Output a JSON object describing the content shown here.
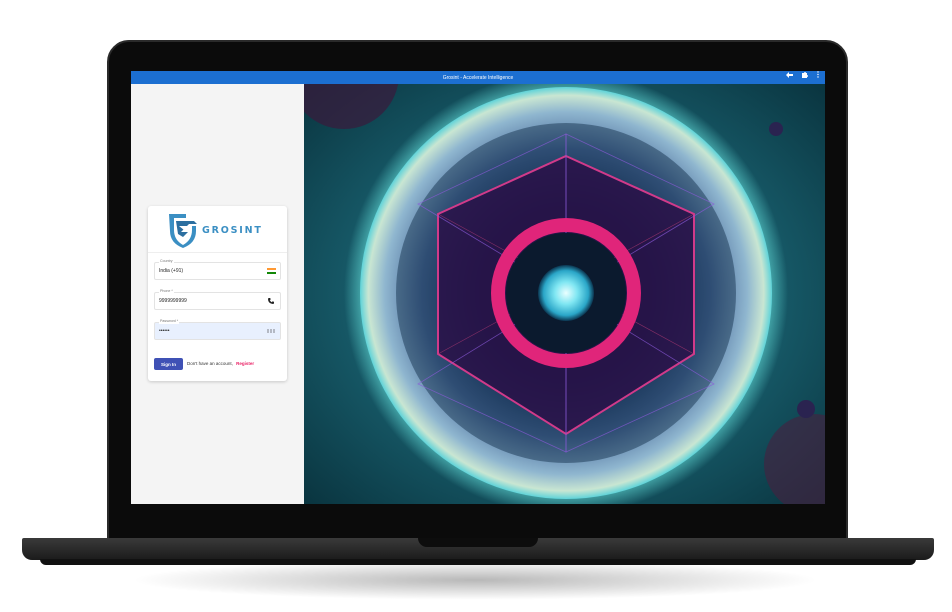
{
  "window": {
    "title": "Grosint - Accelerate Intelligence",
    "icons": [
      "back-arrow-icon",
      "puzzle-icon",
      "kebab-menu-icon"
    ]
  },
  "brand": {
    "name": "GROSINT",
    "accent": "#3b8fc3"
  },
  "form": {
    "country": {
      "label": "Country",
      "value": "India (+91)"
    },
    "phone": {
      "label": "Phone *",
      "value": "9999999999"
    },
    "password": {
      "label": "Password *",
      "value": "••••••"
    },
    "signin_label": "Sign In",
    "no_account_text": "Don't have an account,",
    "register_label": "Register"
  },
  "colors": {
    "titlebar": "#1c6fd1",
    "primary_button": "#3f51b5",
    "register_link": "#e91e63"
  }
}
